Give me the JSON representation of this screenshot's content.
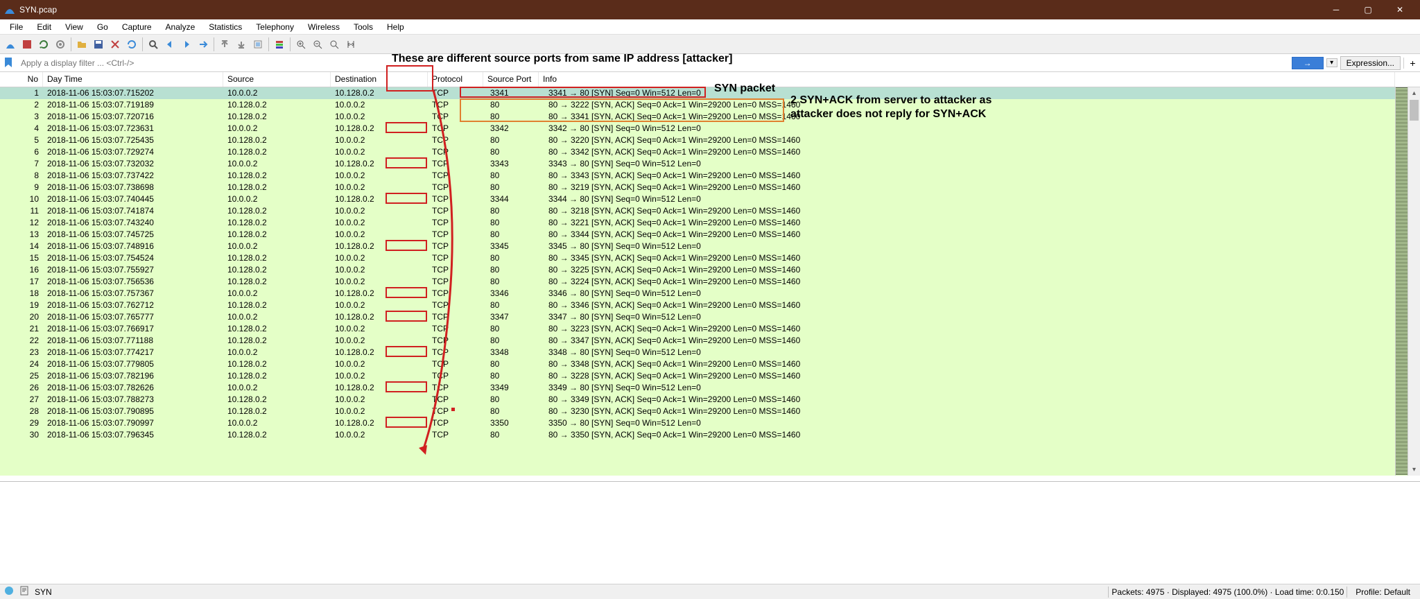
{
  "window": {
    "title": "SYN.pcap"
  },
  "menu": [
    "File",
    "Edit",
    "View",
    "Go",
    "Capture",
    "Analyze",
    "Statistics",
    "Telephony",
    "Wireless",
    "Tools",
    "Help"
  ],
  "filter": {
    "placeholder": "Apply a display filter ... <Ctrl-/>",
    "expression": "Expression..."
  },
  "columns": [
    "No",
    "Day Time",
    "Source",
    "Destination",
    "Protocol",
    "Source Port",
    "Info"
  ],
  "packets": [
    {
      "no": 1,
      "dt": "2018-11-06 15:03:07.715202",
      "src": "10.0.0.2",
      "dst": "10.128.0.2",
      "proto": "TCP",
      "sport": "3341",
      "info": "3341 → 80 [SYN] Seq=0 Win=512 Len=0",
      "sel": true,
      "hlport": false,
      "hlinfo": "red"
    },
    {
      "no": 2,
      "dt": "2018-11-06 15:03:07.719189",
      "src": "10.128.0.2",
      "dst": "10.0.0.2",
      "proto": "TCP",
      "sport": "80",
      "info": "80 → 3222 [SYN, ACK] Seq=0 Ack=1 Win=29200 Len=0 MSS=1460",
      "hlinfo": "orange"
    },
    {
      "no": 3,
      "dt": "2018-11-06 15:03:07.720716",
      "src": "10.128.0.2",
      "dst": "10.0.0.2",
      "proto": "TCP",
      "sport": "80",
      "info": "80 → 3341 [SYN, ACK] Seq=0 Ack=1 Win=29200 Len=0 MSS=1460",
      "hlinfo": "orange"
    },
    {
      "no": 4,
      "dt": "2018-11-06 15:03:07.723631",
      "src": "10.0.0.2",
      "dst": "10.128.0.2",
      "proto": "TCP",
      "sport": "3342",
      "info": "3342 → 80 [SYN] Seq=0 Win=512 Len=0",
      "hlport": true
    },
    {
      "no": 5,
      "dt": "2018-11-06 15:03:07.725435",
      "src": "10.128.0.2",
      "dst": "10.0.0.2",
      "proto": "TCP",
      "sport": "80",
      "info": "80 → 3220 [SYN, ACK] Seq=0 Ack=1 Win=29200 Len=0 MSS=1460"
    },
    {
      "no": 6,
      "dt": "2018-11-06 15:03:07.729274",
      "src": "10.128.0.2",
      "dst": "10.0.0.2",
      "proto": "TCP",
      "sport": "80",
      "info": "80 → 3342 [SYN, ACK] Seq=0 Ack=1 Win=29200 Len=0 MSS=1460"
    },
    {
      "no": 7,
      "dt": "2018-11-06 15:03:07.732032",
      "src": "10.0.0.2",
      "dst": "10.128.0.2",
      "proto": "TCP",
      "sport": "3343",
      "info": "3343 → 80 [SYN] Seq=0 Win=512 Len=0",
      "hlport": true
    },
    {
      "no": 8,
      "dt": "2018-11-06 15:03:07.737422",
      "src": "10.128.0.2",
      "dst": "10.0.0.2",
      "proto": "TCP",
      "sport": "80",
      "info": "80 → 3343 [SYN, ACK] Seq=0 Ack=1 Win=29200 Len=0 MSS=1460"
    },
    {
      "no": 9,
      "dt": "2018-11-06 15:03:07.738698",
      "src": "10.128.0.2",
      "dst": "10.0.0.2",
      "proto": "TCP",
      "sport": "80",
      "info": "80 → 3219 [SYN, ACK] Seq=0 Ack=1 Win=29200 Len=0 MSS=1460"
    },
    {
      "no": 10,
      "dt": "2018-11-06 15:03:07.740445",
      "src": "10.0.0.2",
      "dst": "10.128.0.2",
      "proto": "TCP",
      "sport": "3344",
      "info": "3344 → 80 [SYN] Seq=0 Win=512 Len=0",
      "hlport": true
    },
    {
      "no": 11,
      "dt": "2018-11-06 15:03:07.741874",
      "src": "10.128.0.2",
      "dst": "10.0.0.2",
      "proto": "TCP",
      "sport": "80",
      "info": "80 → 3218 [SYN, ACK] Seq=0 Ack=1 Win=29200 Len=0 MSS=1460"
    },
    {
      "no": 12,
      "dt": "2018-11-06 15:03:07.743240",
      "src": "10.128.0.2",
      "dst": "10.0.0.2",
      "proto": "TCP",
      "sport": "80",
      "info": "80 → 3221 [SYN, ACK] Seq=0 Ack=1 Win=29200 Len=0 MSS=1460"
    },
    {
      "no": 13,
      "dt": "2018-11-06 15:03:07.745725",
      "src": "10.128.0.2",
      "dst": "10.0.0.2",
      "proto": "TCP",
      "sport": "80",
      "info": "80 → 3344 [SYN, ACK] Seq=0 Ack=1 Win=29200 Len=0 MSS=1460"
    },
    {
      "no": 14,
      "dt": "2018-11-06 15:03:07.748916",
      "src": "10.0.0.2",
      "dst": "10.128.0.2",
      "proto": "TCP",
      "sport": "3345",
      "info": "3345 → 80 [SYN] Seq=0 Win=512 Len=0",
      "hlport": true
    },
    {
      "no": 15,
      "dt": "2018-11-06 15:03:07.754524",
      "src": "10.128.0.2",
      "dst": "10.0.0.2",
      "proto": "TCP",
      "sport": "80",
      "info": "80 → 3345 [SYN, ACK] Seq=0 Ack=1 Win=29200 Len=0 MSS=1460"
    },
    {
      "no": 16,
      "dt": "2018-11-06 15:03:07.755927",
      "src": "10.128.0.2",
      "dst": "10.0.0.2",
      "proto": "TCP",
      "sport": "80",
      "info": "80 → 3225 [SYN, ACK] Seq=0 Ack=1 Win=29200 Len=0 MSS=1460"
    },
    {
      "no": 17,
      "dt": "2018-11-06 15:03:07.756536",
      "src": "10.128.0.2",
      "dst": "10.0.0.2",
      "proto": "TCP",
      "sport": "80",
      "info": "80 → 3224 [SYN, ACK] Seq=0 Ack=1 Win=29200 Len=0 MSS=1460"
    },
    {
      "no": 18,
      "dt": "2018-11-06 15:03:07.757367",
      "src": "10.0.0.2",
      "dst": "10.128.0.2",
      "proto": "TCP",
      "sport": "3346",
      "info": "3346 → 80 [SYN] Seq=0 Win=512 Len=0",
      "hlport": true
    },
    {
      "no": 19,
      "dt": "2018-11-06 15:03:07.762712",
      "src": "10.128.0.2",
      "dst": "10.0.0.2",
      "proto": "TCP",
      "sport": "80",
      "info": "80 → 3346 [SYN, ACK] Seq=0 Ack=1 Win=29200 Len=0 MSS=1460"
    },
    {
      "no": 20,
      "dt": "2018-11-06 15:03:07.765777",
      "src": "10.0.0.2",
      "dst": "10.128.0.2",
      "proto": "TCP",
      "sport": "3347",
      "info": "3347 → 80 [SYN] Seq=0 Win=512 Len=0",
      "hlport": true
    },
    {
      "no": 21,
      "dt": "2018-11-06 15:03:07.766917",
      "src": "10.128.0.2",
      "dst": "10.0.0.2",
      "proto": "TCP",
      "sport": "80",
      "info": "80 → 3223 [SYN, ACK] Seq=0 Ack=1 Win=29200 Len=0 MSS=1460"
    },
    {
      "no": 22,
      "dt": "2018-11-06 15:03:07.771188",
      "src": "10.128.0.2",
      "dst": "10.0.0.2",
      "proto": "TCP",
      "sport": "80",
      "info": "80 → 3347 [SYN, ACK] Seq=0 Ack=1 Win=29200 Len=0 MSS=1460"
    },
    {
      "no": 23,
      "dt": "2018-11-06 15:03:07.774217",
      "src": "10.0.0.2",
      "dst": "10.128.0.2",
      "proto": "TCP",
      "sport": "3348",
      "info": "3348 → 80 [SYN] Seq=0 Win=512 Len=0",
      "hlport": true
    },
    {
      "no": 24,
      "dt": "2018-11-06 15:03:07.779805",
      "src": "10.128.0.2",
      "dst": "10.0.0.2",
      "proto": "TCP",
      "sport": "80",
      "info": "80 → 3348 [SYN, ACK] Seq=0 Ack=1 Win=29200 Len=0 MSS=1460"
    },
    {
      "no": 25,
      "dt": "2018-11-06 15:03:07.782196",
      "src": "10.128.0.2",
      "dst": "10.0.0.2",
      "proto": "TCP",
      "sport": "80",
      "info": "80 → 3228 [SYN, ACK] Seq=0 Ack=1 Win=29200 Len=0 MSS=1460"
    },
    {
      "no": 26,
      "dt": "2018-11-06 15:03:07.782626",
      "src": "10.0.0.2",
      "dst": "10.128.0.2",
      "proto": "TCP",
      "sport": "3349",
      "info": "3349 → 80 [SYN] Seq=0 Win=512 Len=0",
      "hlport": true
    },
    {
      "no": 27,
      "dt": "2018-11-06 15:03:07.788273",
      "src": "10.128.0.2",
      "dst": "10.0.0.2",
      "proto": "TCP",
      "sport": "80",
      "info": "80 → 3349 [SYN, ACK] Seq=0 Ack=1 Win=29200 Len=0 MSS=1460"
    },
    {
      "no": 28,
      "dt": "2018-11-06 15:03:07.790895",
      "src": "10.128.0.2",
      "dst": "10.0.0.2",
      "proto": "TCP",
      "sport": "80",
      "info": "80 → 3230 [SYN, ACK] Seq=0 Ack=1 Win=29200 Len=0 MSS=1460"
    },
    {
      "no": 29,
      "dt": "2018-11-06 15:03:07.790997",
      "src": "10.0.0.2",
      "dst": "10.128.0.2",
      "proto": "TCP",
      "sport": "3350",
      "info": "3350 → 80 [SYN] Seq=0 Win=512 Len=0",
      "hlport": true
    },
    {
      "no": 30,
      "dt": "2018-11-06 15:03:07.796345",
      "src": "10.128.0.2",
      "dst": "10.0.0.2",
      "proto": "TCP",
      "sport": "80",
      "info": "80 → 3350 [SYN, ACK] Seq=0 Ack=1 Win=29200 Len=0 MSS=1460"
    }
  ],
  "status": {
    "file": "SYN",
    "packets": "Packets: 4975 · Displayed: 4975 (100.0%) · Load time: 0:0.150",
    "profile": "Profile: Default"
  },
  "annotations": {
    "top": "These are different source ports from same IP address [attacker]",
    "synpkt": "SYN packet",
    "orange1": "2 SYN+ACK from server to attacker as",
    "orange2": "attacker does not reply for SYN+ACK"
  }
}
